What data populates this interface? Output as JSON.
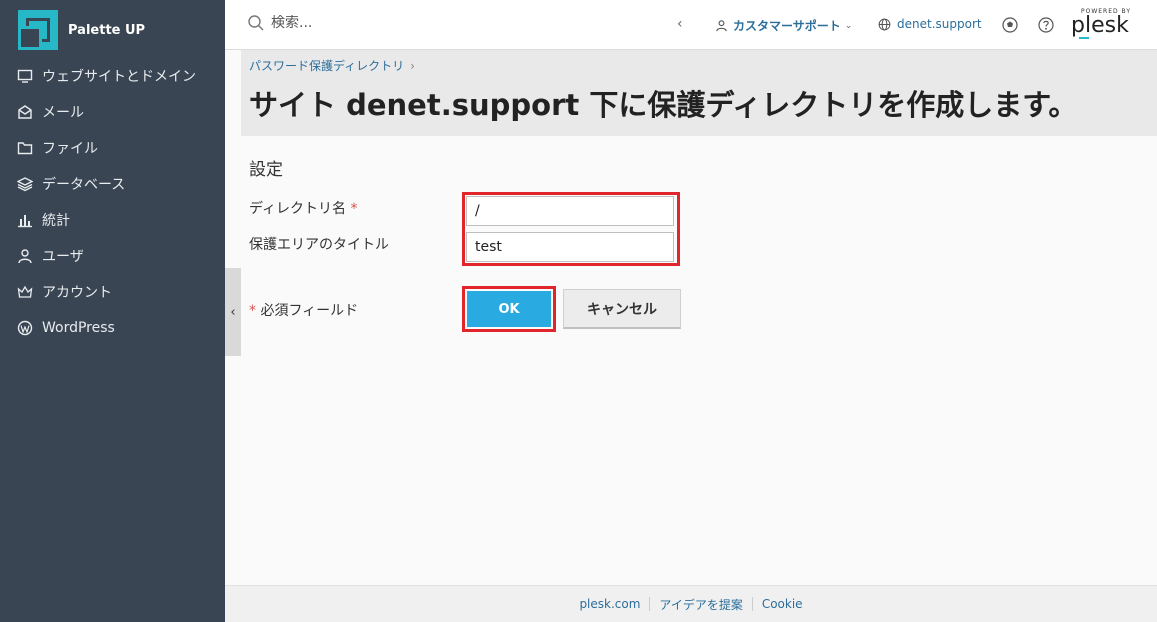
{
  "brand": {
    "name": "Palette UP",
    "accent": "#27b8c8"
  },
  "sidebar": {
    "items": [
      {
        "label": "ウェブサイトとドメイン",
        "icon": "monitor-icon"
      },
      {
        "label": "メール",
        "icon": "mail-icon"
      },
      {
        "label": "ファイル",
        "icon": "folder-icon"
      },
      {
        "label": "データベース",
        "icon": "database-icon"
      },
      {
        "label": "統計",
        "icon": "bar-chart-icon"
      },
      {
        "label": "ユーザ",
        "icon": "user-icon"
      },
      {
        "label": "アカウント",
        "icon": "crown-icon"
      },
      {
        "label": "WordPress",
        "icon": "wordpress-icon"
      }
    ]
  },
  "topbar": {
    "search_placeholder": "検索...",
    "user_label": "カスタマーサポート",
    "domain_label": "denet.support",
    "powered_by": "POWERED BY",
    "product": "plesk"
  },
  "header": {
    "breadcrumb": "パスワード保護ディレクトリ",
    "title": "サイト denet.support 下に保護ディレクトリを作成します。"
  },
  "form": {
    "section_title": "設定",
    "directory_label": "ディレクトリ名",
    "directory_value": "/",
    "title_label": "保護エリアのタイトル",
    "title_value": "test",
    "required_star": "*",
    "required_note": "必須フィールド",
    "ok_label": "OK",
    "cancel_label": "キャンセル"
  },
  "footer": {
    "links": [
      "plesk.com",
      "アイデアを提案",
      "Cookie"
    ]
  },
  "colors": {
    "sidebar_bg": "#3a4553",
    "primary_button": "#29abe2",
    "highlight": "#e0262c",
    "link": "#2c6e9a"
  }
}
